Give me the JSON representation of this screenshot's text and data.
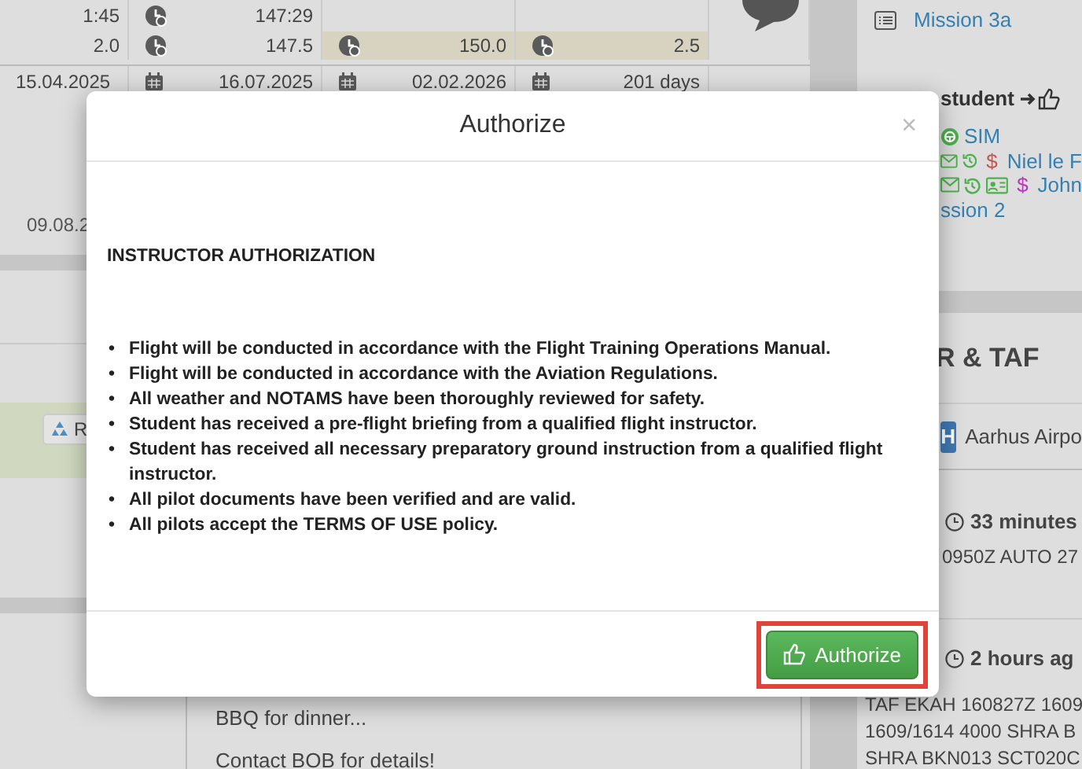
{
  "flight_times": [
    {
      "value": "1:45",
      "total": "147:29"
    },
    {
      "value": "2.0",
      "total": "147.5",
      "extras": [
        {
          "text": "150.0",
          "highlighted": true
        },
        {
          "text": "2.5",
          "highlighted": true
        }
      ]
    }
  ],
  "dates": [
    "15.04.2025",
    "16.07.2025",
    "02.02.2026",
    "201 days"
  ],
  "cut_date": "09.08.2",
  "rebook_button": "R",
  "notes": [
    "BBQ for dinner...",
    "Contact BOB for details!"
  ],
  "mission": "Mission 3a",
  "student_heading": "student",
  "crew": [
    {
      "kind": "sim",
      "name": "SIM"
    },
    {
      "kind": "person",
      "symbol": "$",
      "color": "#c9564e",
      "name": "Niel le F"
    },
    {
      "kind": "card",
      "symbol": "$",
      "color": "#b836b8",
      "name": "John"
    }
  ],
  "lesson": "ssion 2",
  "weather": {
    "title": "R & TAF",
    "airport_code": "H",
    "airport": "Aarhus Airpo",
    "metar_age": "33 minutes",
    "metar": "0950Z AUTO 27",
    "taf_age": "2 hours ag",
    "taf": [
      "TAF EKAH 160827Z 1609",
      "1609/1614 4000 SHRA B",
      "SHRA BKN013 SCT020C"
    ]
  },
  "modal": {
    "title": "Authorize",
    "close": "×",
    "heading": "INSTRUCTOR AUTHORIZATION",
    "bullet": "•",
    "items": [
      "Flight will be conducted in accordance with the Flight Training Operations Manual.",
      "Flight will be conducted in accordance with the Aviation Regulations.",
      "All weather and NOTAMS have been thoroughly reviewed for safety.",
      "Student has received a pre-flight briefing from a qualified flight instructor.",
      "Student has received all necessary preparatory ground instruction from a qualified flight instructor.",
      "All pilot documents have been verified and are valid.",
      "All pilots accept the TERMS OF USE policy."
    ],
    "button": "Authorize"
  }
}
